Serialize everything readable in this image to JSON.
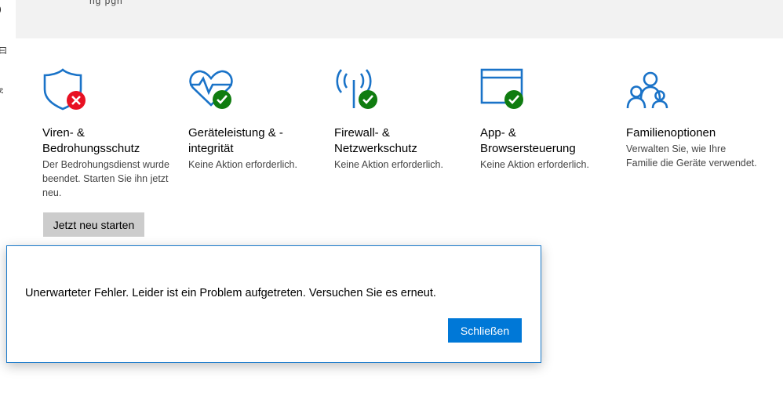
{
  "header": {
    "partial_text": "ng   pgh"
  },
  "left_rail": {
    "glyphs": [
      ")",
      "曰",
      "ደ"
    ]
  },
  "tiles": [
    {
      "title": "Viren- & Bedrohungsschutz",
      "description": "Der Bedrohungsdienst wurde beendet. Starten Sie ihn jetzt neu.",
      "icon": "shield-icon",
      "status_icon": "error-x-icon",
      "status_color": "#e81123"
    },
    {
      "title": "Geräteleistung & -integrität",
      "description": "Keine Aktion erforderlich.",
      "icon": "heart-pulse-icon",
      "status_icon": "check-icon",
      "status_color": "#107c10"
    },
    {
      "title": "Firewall- & Netzwerkschutz",
      "description": "Keine Aktion erforderlich.",
      "icon": "antenna-icon",
      "status_icon": "check-icon",
      "status_color": "#107c10"
    },
    {
      "title": "App- & Browsersteuerung",
      "description": "Keine Aktion erforderlich.",
      "icon": "browser-window-icon",
      "status_icon": "check-icon",
      "status_color": "#107c10"
    },
    {
      "title": "Familienoptionen",
      "description": "Verwalten Sie, wie Ihre Familie die Geräte verwendet.",
      "icon": "family-icon"
    }
  ],
  "restart_button": {
    "label": "Jetzt neu starten"
  },
  "dialog": {
    "message": "Unerwarteter Fehler. Leider ist ein Problem aufgetreten. Versuchen Sie es erneut.",
    "close_label": "Schließen"
  },
  "colors": {
    "accent": "#0078d7",
    "icon_blue": "#1a73c8",
    "error": "#e81123",
    "ok": "#107c10"
  }
}
